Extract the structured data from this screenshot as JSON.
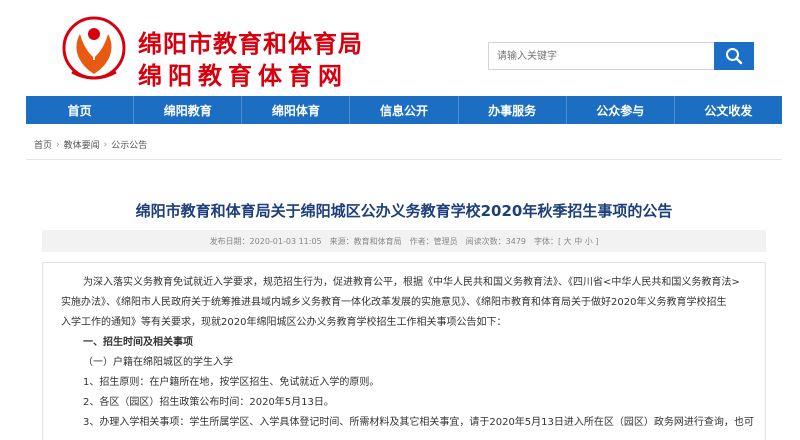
{
  "site": {
    "name_line1": "绵阳市教育和体育局",
    "name_line2": "绵阳教育体育网",
    "brand_color": "#d7000f",
    "nav_color": "#1c6ec3"
  },
  "search": {
    "placeholder": "请输入关键字",
    "icon": "search-icon"
  },
  "nav": {
    "items": [
      "首页",
      "绵阳教育",
      "绵阳体育",
      "信息公开",
      "办事服务",
      "公众参与",
      "公文收发"
    ]
  },
  "breadcrumb": {
    "items": [
      "首页",
      "教体要闻",
      "公示公告"
    ]
  },
  "article": {
    "title": "绵阳市教育和体育局关于绵阳城区公办义务教育学校2020年秋季招生事项的公告",
    "meta": {
      "publish_time": "发布日期：2020-01-03 11:05",
      "source": "来源：教育和体育局",
      "author": "作者：管理员",
      "views": "阅读次数：3479",
      "font_size": "字体：[ 大 中 小 ]"
    },
    "paragraphs": {
      "p1_line1": "为深入落实义务教育免试就近入学要求，规范招生行为，促进教育公平，根据《中华人民共和国义务教育法》、《四川省<中华人民共和国义务教育法>",
      "p1_line2": "实施办法》、《绵阳市人民政府关于统筹推进县域内城乡义务教育一体化改革发展的实施意见》、《绵阳市教育和体育局关于做好2020年义务教育学校招生",
      "p1_line3": "入学工作的通知》等有关要求，现就2020年绵阳城区公办义务教育学校招生工作相关事项公告如下：",
      "section1": "一、招生时间及相关事项",
      "sub1": "（一）户籍在绵阳城区的学生入学",
      "item1": "1、招生原则：在户籍所在地，按学区招生、免试就近入学的原则。",
      "item2": "2、各区（园区）招生政策公布时间：2020年5月13日。",
      "item3": "3、办理入学相关事项：学生所属学区、入学具体登记时间、所需材料及其它相关事宜，请于2020年5月13日进入所在区（园区）政务网进行查询，也可"
    }
  }
}
